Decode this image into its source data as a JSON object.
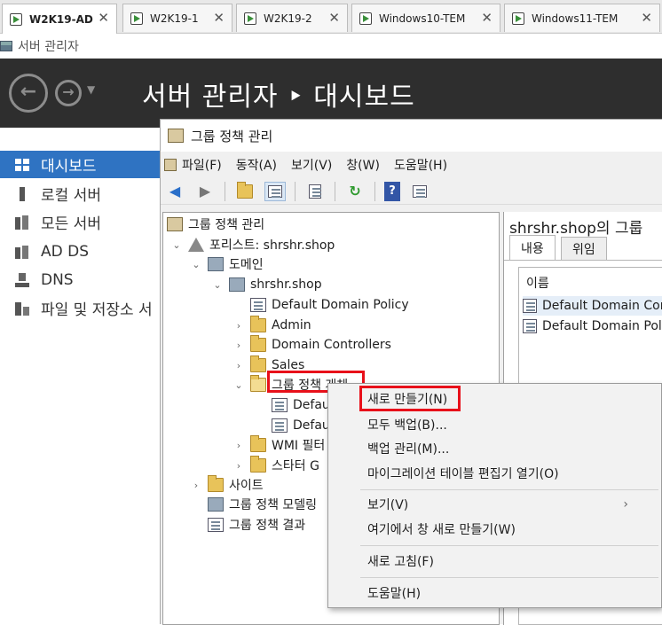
{
  "tabs": [
    {
      "label": "W2K19-AD",
      "active": true
    },
    {
      "label": "W2K19-1",
      "active": false
    },
    {
      "label": "W2K19-2",
      "active": false
    },
    {
      "label": "Windows10-TEM",
      "active": false
    },
    {
      "label": "Windows11-TEM",
      "active": false
    }
  ],
  "app_title": "서버 관리자",
  "header": {
    "title": "서버 관리자 ‣ 대시보드"
  },
  "left_nav": [
    {
      "label": "대시보드",
      "icon": "dashboard-icon",
      "selected": true
    },
    {
      "label": "로컬 서버",
      "icon": "server-icon"
    },
    {
      "label": "모든 서버",
      "icon": "servers-icon"
    },
    {
      "label": "AD DS",
      "icon": "directory-icon"
    },
    {
      "label": "DNS",
      "icon": "dns-icon"
    },
    {
      "label": "파일 및 저장소 서",
      "icon": "storage-icon"
    }
  ],
  "gpmc": {
    "title": "그룹 정책 관리",
    "menu": [
      "파일(F)",
      "동작(A)",
      "보기(V)",
      "창(W)",
      "도움말(H)"
    ],
    "tree": [
      {
        "label": "그룹 정책 관리"
      },
      {
        "label": "포리스트: shrshr.shop"
      },
      {
        "label": "도메인"
      },
      {
        "label": "shrshr.shop"
      },
      {
        "label": "Default Domain Policy"
      },
      {
        "label": "Admin"
      },
      {
        "label": "Domain Controllers"
      },
      {
        "label": "Sales"
      },
      {
        "label": "그룹 정책 개체"
      },
      {
        "label": "Defau"
      },
      {
        "label": "Defau"
      },
      {
        "label": "WMI 필터"
      },
      {
        "label": "스타터 G"
      },
      {
        "label": "사이트"
      },
      {
        "label": "그룹 정책 모델링"
      },
      {
        "label": "그룹 정책 결과"
      }
    ],
    "right_pane": {
      "title": "shrshr.shop의 그룹",
      "tabs": [
        "내용",
        "위임"
      ],
      "column": "이름",
      "rows": [
        "Default Domain Con",
        "Default Domain Poli"
      ]
    }
  },
  "context_menu": [
    "새로 만들기(N)",
    "모두 백업(B)...",
    "백업 관리(M)...",
    "마이그레이션 테이블 편집기 열기(O)",
    "보기(V)",
    "여기에서 창 새로 만들기(W)",
    "새로 고침(F)",
    "도움말(H)"
  ],
  "colors": {
    "highlight": "#e8101a",
    "nav_selected": "#2f73c2",
    "header_bg": "#2e2e2e"
  }
}
